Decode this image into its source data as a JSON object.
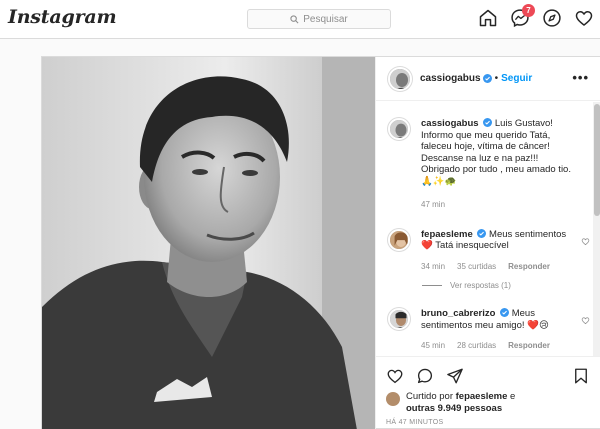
{
  "app": {
    "logo_text": "Instagram"
  },
  "search": {
    "placeholder": "Pesquisar"
  },
  "nav": {
    "home_icon": "home-icon",
    "messages_icon": "messenger-icon",
    "messages_badge": "7",
    "explore_icon": "compass-icon",
    "activity_icon": "heart-icon"
  },
  "post": {
    "author": "cassiogabus",
    "verified": true,
    "separator": "•",
    "follow_label": "Seguir",
    "more_label": "•••",
    "caption": {
      "username": "cassiogabus",
      "text": "Luis Gustavo! Informo que meu querido Tatá, faleceu hoje, vítima de câncer! Descanse na luz e na paz!!!",
      "text2": "Obrigado por tudo , meu amado tio.",
      "emojis": "🙏✨🐢",
      "time": "47 min"
    },
    "comments": [
      {
        "username": "fepaesleme",
        "verified": true,
        "text": "Meus sentimentos",
        "text2": "❤️ Tatá inesquecível",
        "time": "34 min",
        "likes": "35 curtidas",
        "reply": "Responder",
        "view_replies": "Ver respostas (1)"
      },
      {
        "username": "bruno_cabrerizo",
        "verified": true,
        "text": "Meus sentimentos meu amigo! ❤️😢",
        "time": "45 min",
        "likes": "28 curtidas",
        "reply": "Responder"
      }
    ],
    "liked_by": {
      "prefix": "Curtido por",
      "user": "fepaesleme",
      "suffix": "e",
      "others": "outras 9.949 pessoas"
    },
    "timestamp": "HÁ 47 MINUTOS"
  },
  "colors": {
    "accent": "#0095f6",
    "badge": "#ed4956",
    "heart": "#ed4956",
    "border": "#dbdbdb"
  }
}
